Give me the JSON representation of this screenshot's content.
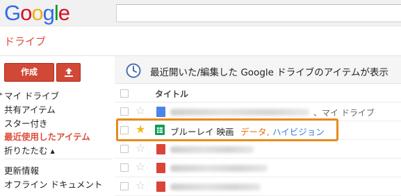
{
  "header": {
    "logo_letters": [
      "G",
      "o",
      "o",
      "g",
      "l",
      "e"
    ],
    "logo_colors": [
      "#3369e8",
      "#d50f25",
      "#eeb211",
      "#3369e8",
      "#009925",
      "#d50f25"
    ]
  },
  "app": {
    "title": "ドライブ"
  },
  "sidebar": {
    "create_label": "作成",
    "items": [
      {
        "label": "マイ ドライブ"
      },
      {
        "label": "共有アイテム"
      },
      {
        "label": "スター付き"
      },
      {
        "label": "最近使用したアイテム"
      },
      {
        "label": "折りたたむ ▴"
      },
      {
        "label": "更新情報"
      },
      {
        "label": "オフライン ドキュメント"
      }
    ]
  },
  "banner": {
    "text": "最近開いた/編集した Google ドライブのアイテムが表示"
  },
  "list": {
    "column_title": "タイトル",
    "first_row_location": "、マイ ドライブ",
    "highlighted": {
      "title": "ブルーレイ 映画",
      "tags": [
        {
          "label": "データ,",
          "color": "#e8710a"
        },
        {
          "label": "ハイビジョン",
          "color": "#3b7ddd"
        }
      ]
    }
  },
  "colors": {
    "accent_red": "#d14836",
    "highlight_border": "#e88a1a",
    "doc_blue": "#4a86e8",
    "sheet_green": "#0f9d58",
    "slides_red": "#db4437"
  }
}
